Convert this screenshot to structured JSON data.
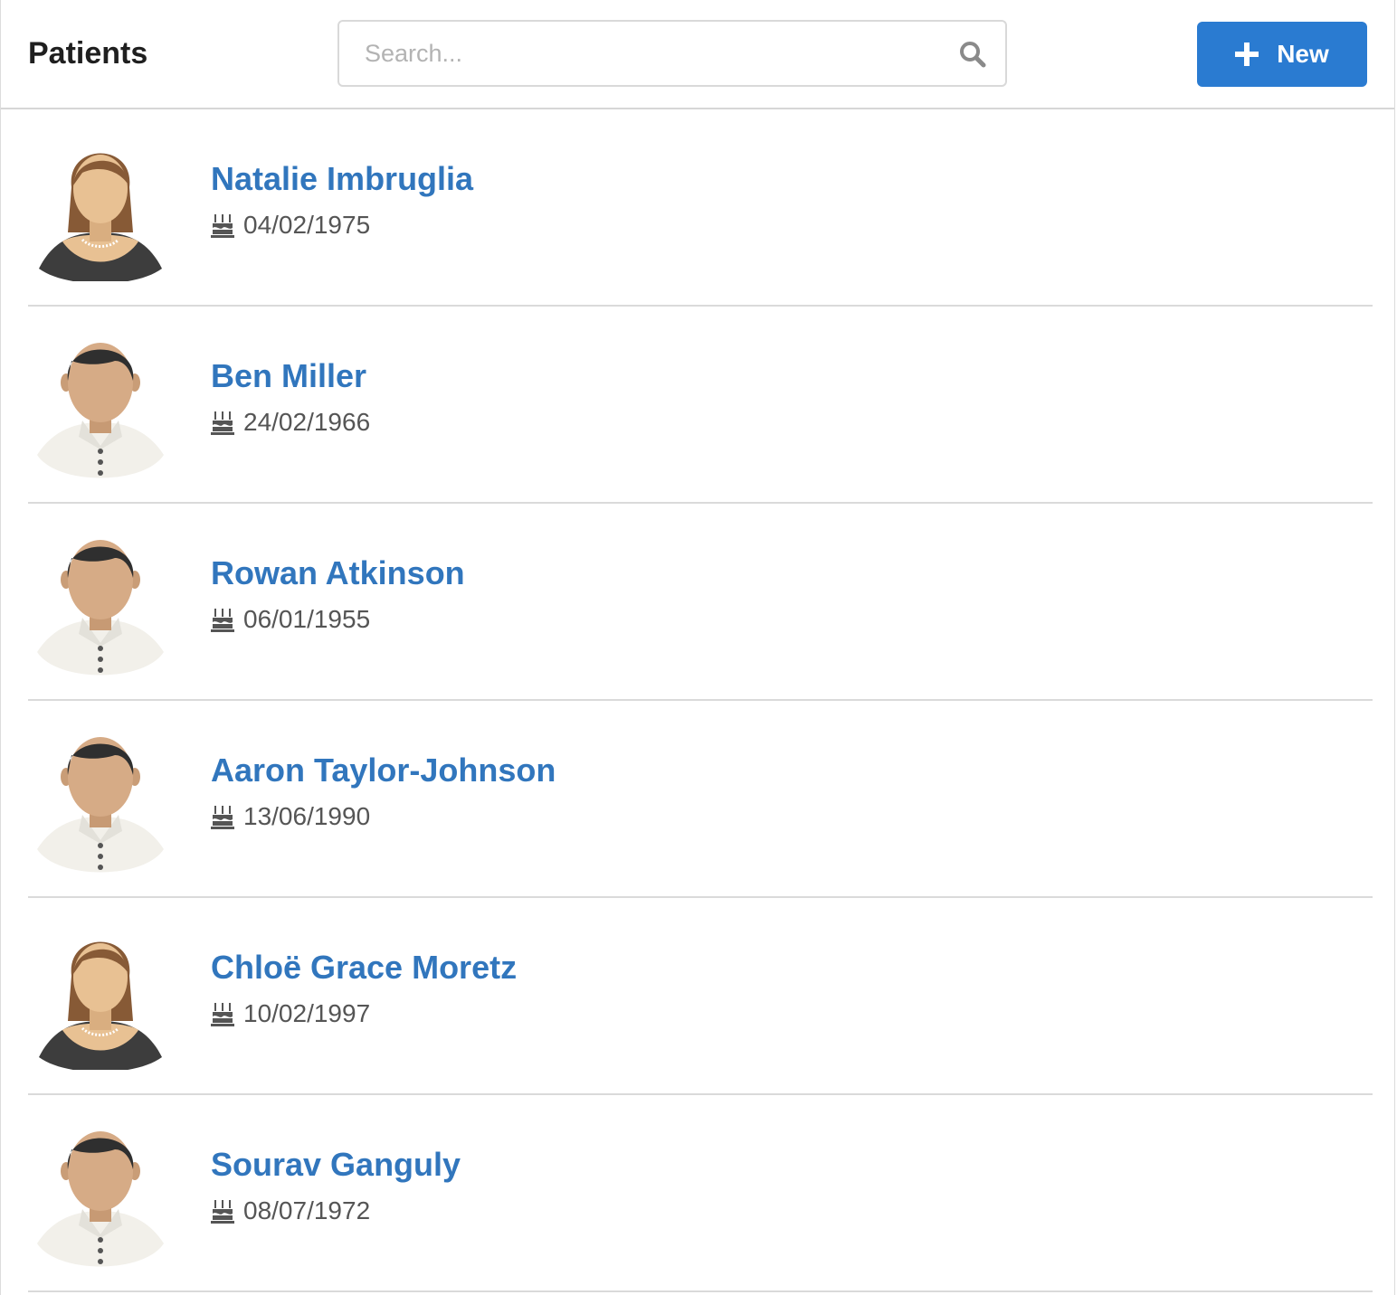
{
  "header": {
    "title": "Patients",
    "search_placeholder": "Search...",
    "new_button_label": "New"
  },
  "colors": {
    "accent": "#2a7bd1",
    "link": "#3176bd",
    "hair_female": "#875a36",
    "hair_male": "#2f2f2f",
    "skin_female": "#e8c193",
    "skin_male": "#d6ab86"
  },
  "patients": [
    {
      "name": "Natalie Imbruglia",
      "dob": "04/02/1975",
      "avatar": "female-avatar-icon"
    },
    {
      "name": "Ben Miller",
      "dob": "24/02/1966",
      "avatar": "male-avatar-icon"
    },
    {
      "name": "Rowan Atkinson",
      "dob": "06/01/1955",
      "avatar": "male-avatar-icon"
    },
    {
      "name": "Aaron Taylor-Johnson",
      "dob": "13/06/1990",
      "avatar": "male-avatar-icon"
    },
    {
      "name": "Chloë Grace Moretz",
      "dob": "10/02/1997",
      "avatar": "female-avatar-icon"
    },
    {
      "name": "Sourav Ganguly",
      "dob": "08/07/1972",
      "avatar": "male-avatar-icon"
    }
  ]
}
